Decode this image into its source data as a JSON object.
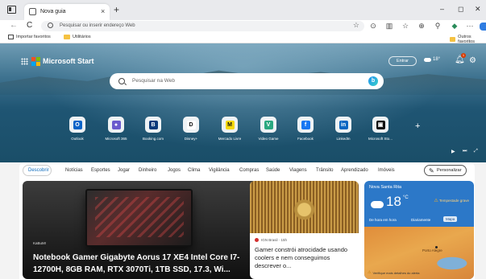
{
  "browser": {
    "tab_title": "Nova guia",
    "tab_close": "×",
    "new_tab": "+",
    "window_controls": [
      "–",
      "◻",
      "✕"
    ],
    "nav": {
      "back": "←",
      "refresh": "C"
    },
    "address_placeholder": "Pesquisar ou inserir endereço Web",
    "toolbar_icons": [
      "star-icon",
      "reader-icon",
      "split-screen-icon",
      "favorites-icon",
      "collections-icon",
      "extensions-icon",
      "copilot-icon",
      "more-icon",
      "profile-icon"
    ],
    "favorites": {
      "import": "Importar favoritos",
      "utilities": "Utilitários",
      "other": "Outros favoritos"
    }
  },
  "header": {
    "brand": "Microsoft Start",
    "sign_in": "Entrar",
    "temperature": "18°",
    "notification_count": "1",
    "search_placeholder": "Pesquisar na Web",
    "bing_glyph": "b"
  },
  "quick_links": [
    {
      "label": "Outlook",
      "color": "#0a64c8",
      "glyph": "O"
    },
    {
      "label": "Microsoft 365",
      "color": "#6a5acd",
      "glyph": "●"
    },
    {
      "label": "Booking.com",
      "color": "#0b3a7a",
      "glyph": "B"
    },
    {
      "label": "Disney+",
      "color": "#ffffff",
      "glyph": "D"
    },
    {
      "label": "Mercado Livre",
      "color": "#f5d90a",
      "glyph": "M"
    },
    {
      "label": "Video Game",
      "color": "#2aa880",
      "glyph": "V"
    },
    {
      "label": "Facebook",
      "color": "#1877f2",
      "glyph": "f"
    },
    {
      "label": "LinkedIn",
      "color": "#0a66c2",
      "glyph": "in"
    },
    {
      "label": "Microsoft Sto...",
      "color": "#111111",
      "glyph": "▣"
    }
  ],
  "add_site": "+",
  "feed_nav": {
    "items": [
      "Descobrir",
      "Notícias",
      "Esportes",
      "Jogar",
      "Dinheiro",
      "Jogos",
      "Clima",
      "Vigilância",
      "Compras",
      "Saúde",
      "Viagens",
      "Trânsito",
      "Aprendizado",
      "Imóveis"
    ],
    "personalize": "Personalizar"
  },
  "cards": {
    "main": {
      "source": "KaBuM!",
      "title": "Notebook Gamer Gigabyte Aorus 17 XE4 Intel Core I7-12700H, 8GB RAM, RTX 3070Ti, 1TB SSD, 17.3, Wi..."
    },
    "second": {
      "source": "IGN Brasil · 15h",
      "title": "Gamer constrói atrocidade usando coolers e nem conseguimos descrever o..."
    },
    "weather": {
      "location": "Nova Santa Rita",
      "temp": "18",
      "unit": "°C",
      "alert": "Tempestade grave",
      "tabs": [
        "De hora em hora",
        "Diariamente",
        "Mapa"
      ],
      "map_city": "Porto Alegre",
      "map_footer": "Verifique mais detalhes do alerta"
    }
  }
}
